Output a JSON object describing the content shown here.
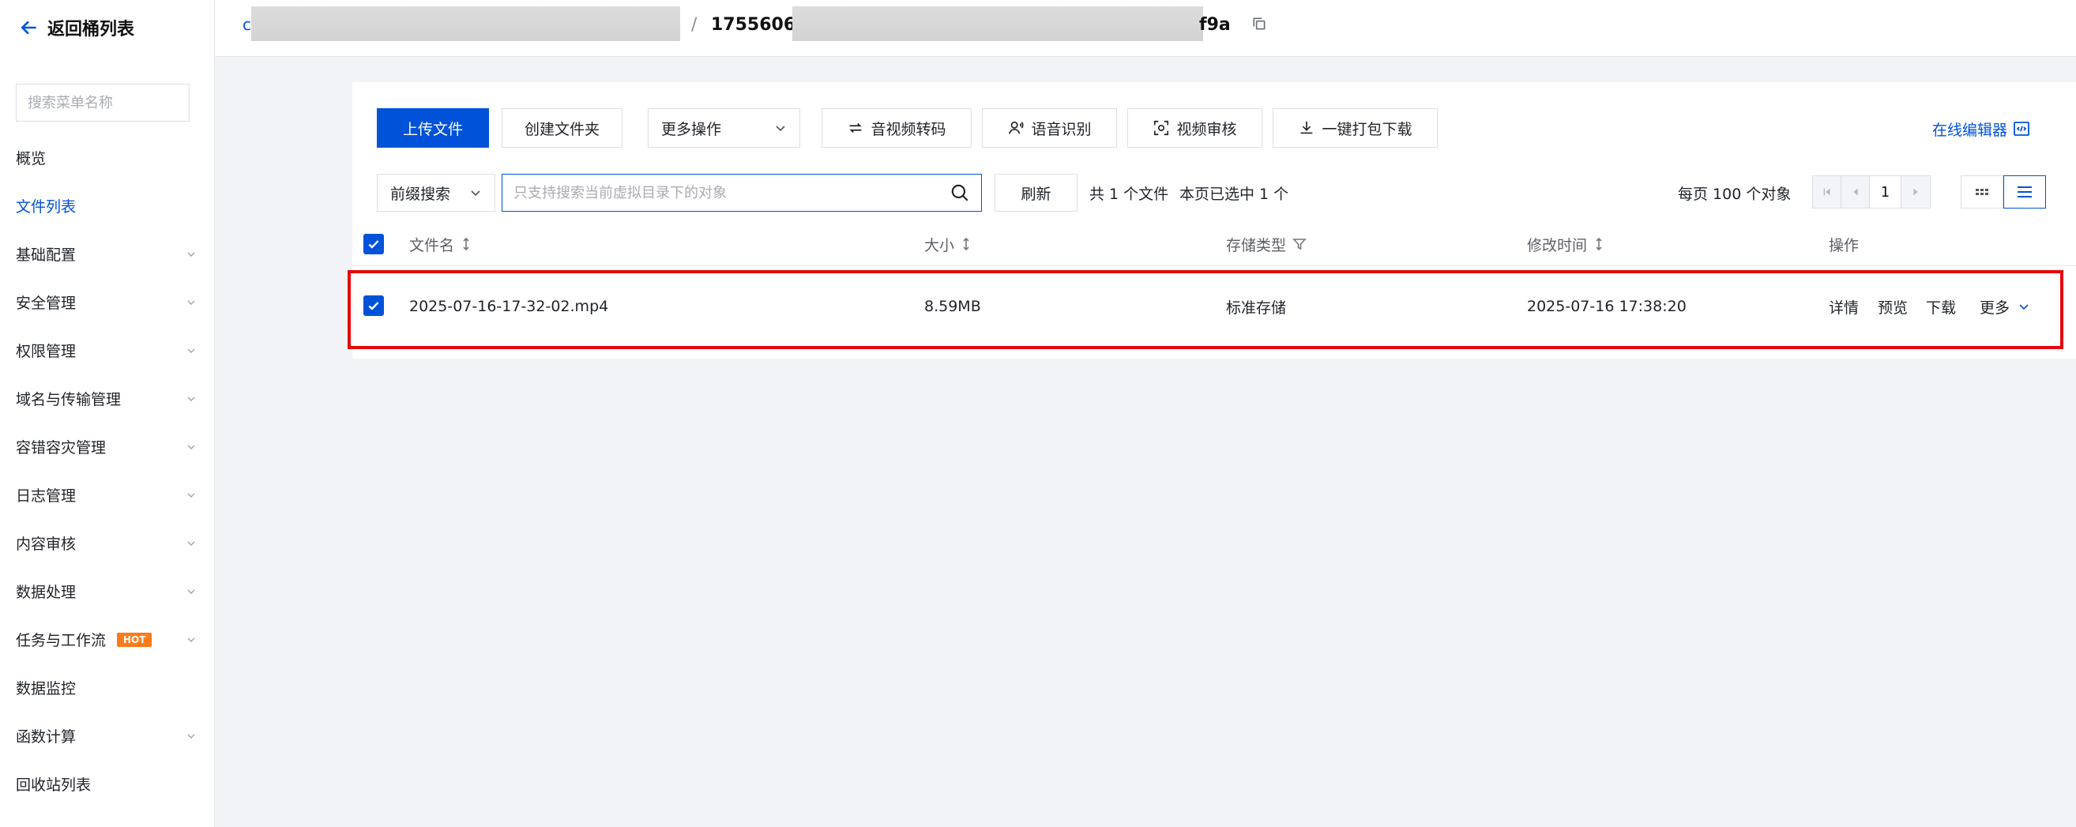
{
  "sidebar": {
    "back_label": "返回桶列表",
    "search_placeholder": "搜索菜单名称",
    "items": [
      {
        "label": "概览",
        "has_arrow": false
      },
      {
        "label": "文件列表",
        "active": true,
        "has_arrow": false
      },
      {
        "label": "基础配置",
        "has_arrow": true
      },
      {
        "label": "安全管理",
        "has_arrow": true
      },
      {
        "label": "权限管理",
        "has_arrow": true
      },
      {
        "label": "域名与传输管理",
        "has_arrow": true
      },
      {
        "label": "容错容灾管理",
        "has_arrow": true
      },
      {
        "label": "日志管理",
        "has_arrow": true
      },
      {
        "label": "内容审核",
        "has_arrow": true
      },
      {
        "label": "数据处理",
        "has_arrow": true
      },
      {
        "label": "任务与工作流",
        "badge": "HOT",
        "has_arrow": true
      },
      {
        "label": "数据监控",
        "has_arrow": false
      },
      {
        "label": "函数计算",
        "has_arrow": true
      },
      {
        "label": "回收站列表",
        "has_arrow": false
      }
    ]
  },
  "header": {
    "bucket_prefix": "c",
    "separator": "/",
    "path_start": "17556068",
    "path_end": "f9a"
  },
  "toolbar": {
    "upload": "上传文件",
    "create_folder": "创建文件夹",
    "more_actions": "更多操作",
    "av_transcode": "音视频转码",
    "speech_recognition": "语音识别",
    "video_audit": "视频审核",
    "pack_download": "一键打包下载",
    "online_editor": "在线编辑器"
  },
  "filter": {
    "search_mode": "前缀搜索",
    "search_placeholder": "只支持搜索当前虚拟目录下的对象",
    "refresh": "刷新",
    "total": "共 1 个文件",
    "selected": "本页已选中 1 个",
    "per_page": "每页 100 个对象",
    "page": "1"
  },
  "table": {
    "headers": {
      "name": "文件名",
      "size": "大小",
      "storage": "存储类型",
      "modified": "修改时间",
      "actions": "操作"
    },
    "rows": [
      {
        "name": "2025-07-16-17-32-02.mp4",
        "size": "8.59MB",
        "storage": "标准存储",
        "modified": "2025-07-16 17:38:20",
        "actions": [
          "详情",
          "预览",
          "下载",
          "更多"
        ]
      }
    ]
  },
  "colors": {
    "accent": "#0052d9",
    "highlight": "#e5060c",
    "hot": "#ff7a1a"
  }
}
